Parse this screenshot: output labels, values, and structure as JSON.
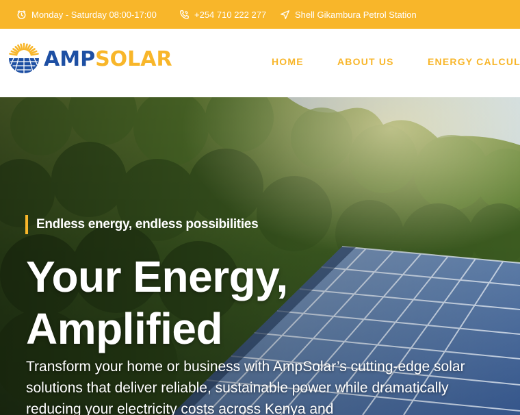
{
  "topbar": {
    "hours": "Monday - Saturday 08:00-17:00",
    "phone": "+254 710 222 277",
    "location": "Shell Gikambura Petrol Station",
    "hours_icon": "clock-icon",
    "phone_icon": "phone-icon",
    "location_icon": "location-arrow-icon"
  },
  "brand": {
    "part1": "AMP",
    "part2": "SOLAR",
    "primary_color": "#1d4fa3",
    "accent_color": "#f8b62a"
  },
  "nav": {
    "items": [
      "HOME",
      "ABOUT US",
      "ENERGY CALCULA"
    ]
  },
  "hero": {
    "tagline": "Endless energy, endless possibilities",
    "headline_line1": "Your Energy,",
    "headline_line2": "Amplified",
    "description": "Transform your home or business with AmpSolar’s cutting-edge solar solutions that deliver reliable, sustainable power while dramatically reducing your electricity costs across Kenya and"
  }
}
